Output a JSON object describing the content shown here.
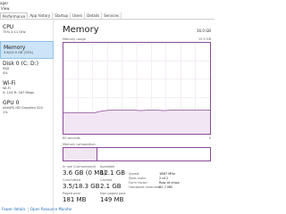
{
  "window": {
    "title": "ager"
  },
  "menu": {
    "view_label": "View"
  },
  "tabs": [
    {
      "label": "Performance",
      "active": true
    },
    {
      "label": "App history"
    },
    {
      "label": "Startup"
    },
    {
      "label": "Users"
    },
    {
      "label": "Details"
    },
    {
      "label": "Services"
    }
  ],
  "sidebar": {
    "items": [
      {
        "title": "CPU",
        "sub1": "75% 2.11 GHz",
        "sub2": ""
      },
      {
        "title": "Memory",
        "sub1": "3.6/15.9 GB (23%)",
        "sub2": ""
      },
      {
        "title": "Disk 0 (C: D:)",
        "sub1": "SSD",
        "sub2": "4%"
      },
      {
        "title": "Wi-Fi",
        "sub1": "Wi-Fi",
        "sub2": "S: 104  R: 167 Mbps"
      },
      {
        "title": "GPU 0",
        "sub1": "Intel(R) HD Graphics 520",
        "sub2": "1%"
      }
    ]
  },
  "main": {
    "title": "Memory",
    "total": "16.0 GB",
    "usage_label": "Memory usage",
    "usage_max": "15.9 GB",
    "axis_left": "60 seconds",
    "axis_right": "0",
    "composition_label": "Memory composition",
    "composition_used_fraction": 0.23,
    "graph_line": [
      0.77,
      0.77,
      0.77,
      0.77,
      0.77,
      0.75,
      0.74,
      0.74,
      0.74,
      0.74,
      0.745,
      0.74,
      0.74,
      0.745,
      0.74,
      0.74,
      0.74,
      0.74,
      0.74,
      0.74
    ]
  },
  "stats": {
    "in_use_label": "In use (Compressed)",
    "in_use_value": "3.6 GB (0 MB)",
    "available_label": "Available",
    "available_value": "12.1 GB",
    "committed_label": "Committed",
    "committed_value": "3.5/18.3 GB",
    "cached_label": "Cached",
    "cached_value": "2.1 GB",
    "paged_label": "Paged pool",
    "paged_value": "181 MB",
    "nonpaged_label": "Non-paged pool",
    "nonpaged_value": "149 MB"
  },
  "properties": {
    "speed_k": "Speed:",
    "speed_v": "1867 MHz",
    "slots_k": "Slots used:",
    "slots_v": "2 of 2",
    "form_k": "Form factor:",
    "form_v": "Row of chips",
    "hw_k": "Hardware reserved:",
    "hw_v": "62.7 MB"
  },
  "bottom": {
    "fewer_details": "Fewer details",
    "open_monitor": "Open Resource Monitor"
  },
  "colors": {
    "accent": "#8a4b96",
    "fill": "#f2e6f4",
    "selected": "#cce4f7",
    "link": "#2a6fb8"
  }
}
